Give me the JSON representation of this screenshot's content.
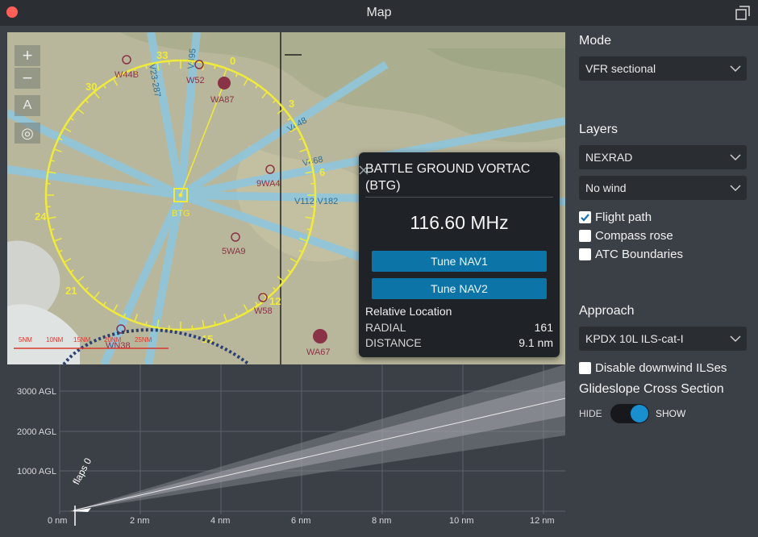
{
  "window": {
    "title": "Map"
  },
  "map": {
    "controls": [
      "+",
      "−",
      "A",
      "◎"
    ],
    "navaid": {
      "label": "BTG"
    },
    "airports": [
      "W44B",
      "W52",
      "WA87",
      "9WA4",
      "5WA9",
      "W58",
      "WA67",
      "WN38"
    ],
    "airways": [
      "V23-287",
      "V495",
      "V448",
      "V468",
      "V112-V182"
    ],
    "compass_labels": [
      "0",
      "3",
      "6",
      "12",
      "15",
      "21",
      "24",
      "30",
      "33"
    ],
    "scale_labels": [
      "5NM",
      "10NM",
      "15NM",
      "20NM",
      "25NM"
    ],
    "colors": {
      "compass": "#f0ea3a",
      "airway": "#8fc6dc",
      "airport": "#8a3246"
    }
  },
  "popup": {
    "name": "BATTLE GROUND VORTAC (BTG)",
    "frequency": "116.60 MHz",
    "tune_nav1": "Tune NAV1",
    "tune_nav2": "Tune NAV2",
    "relative_location_label": "Relative Location",
    "radial_label": "RADIAL",
    "radial_value": "161",
    "distance_label": "DISTANCE",
    "distance_value": "9.1 nm"
  },
  "cross_section": {
    "y_labels": [
      "3000 AGL",
      "2000 AGL",
      "1000 AGL"
    ],
    "x_labels": [
      "0 nm",
      "2 nm",
      "4 nm",
      "6 nm",
      "8 nm",
      "10 nm",
      "12 nm"
    ],
    "annotation": "flaps 0"
  },
  "panel": {
    "mode_header": "Mode",
    "mode_value": "VFR sectional",
    "layers_header": "Layers",
    "layer1_value": "NEXRAD",
    "layer2_value": "No wind",
    "flight_path_label": "Flight path",
    "flight_path_checked": true,
    "compass_rose_label": "Compass rose",
    "compass_rose_checked": false,
    "atc_label": "ATC Boundaries",
    "atc_checked": false,
    "approach_header": "Approach",
    "approach_value": "KPDX 10L ILS-cat-I",
    "disable_ils_label": "Disable downwind ILSes",
    "disable_ils_checked": false,
    "glideslope_header": "Glideslope Cross Section",
    "toggle_hide": "HIDE",
    "toggle_show": "SHOW",
    "toggle_on": true
  }
}
